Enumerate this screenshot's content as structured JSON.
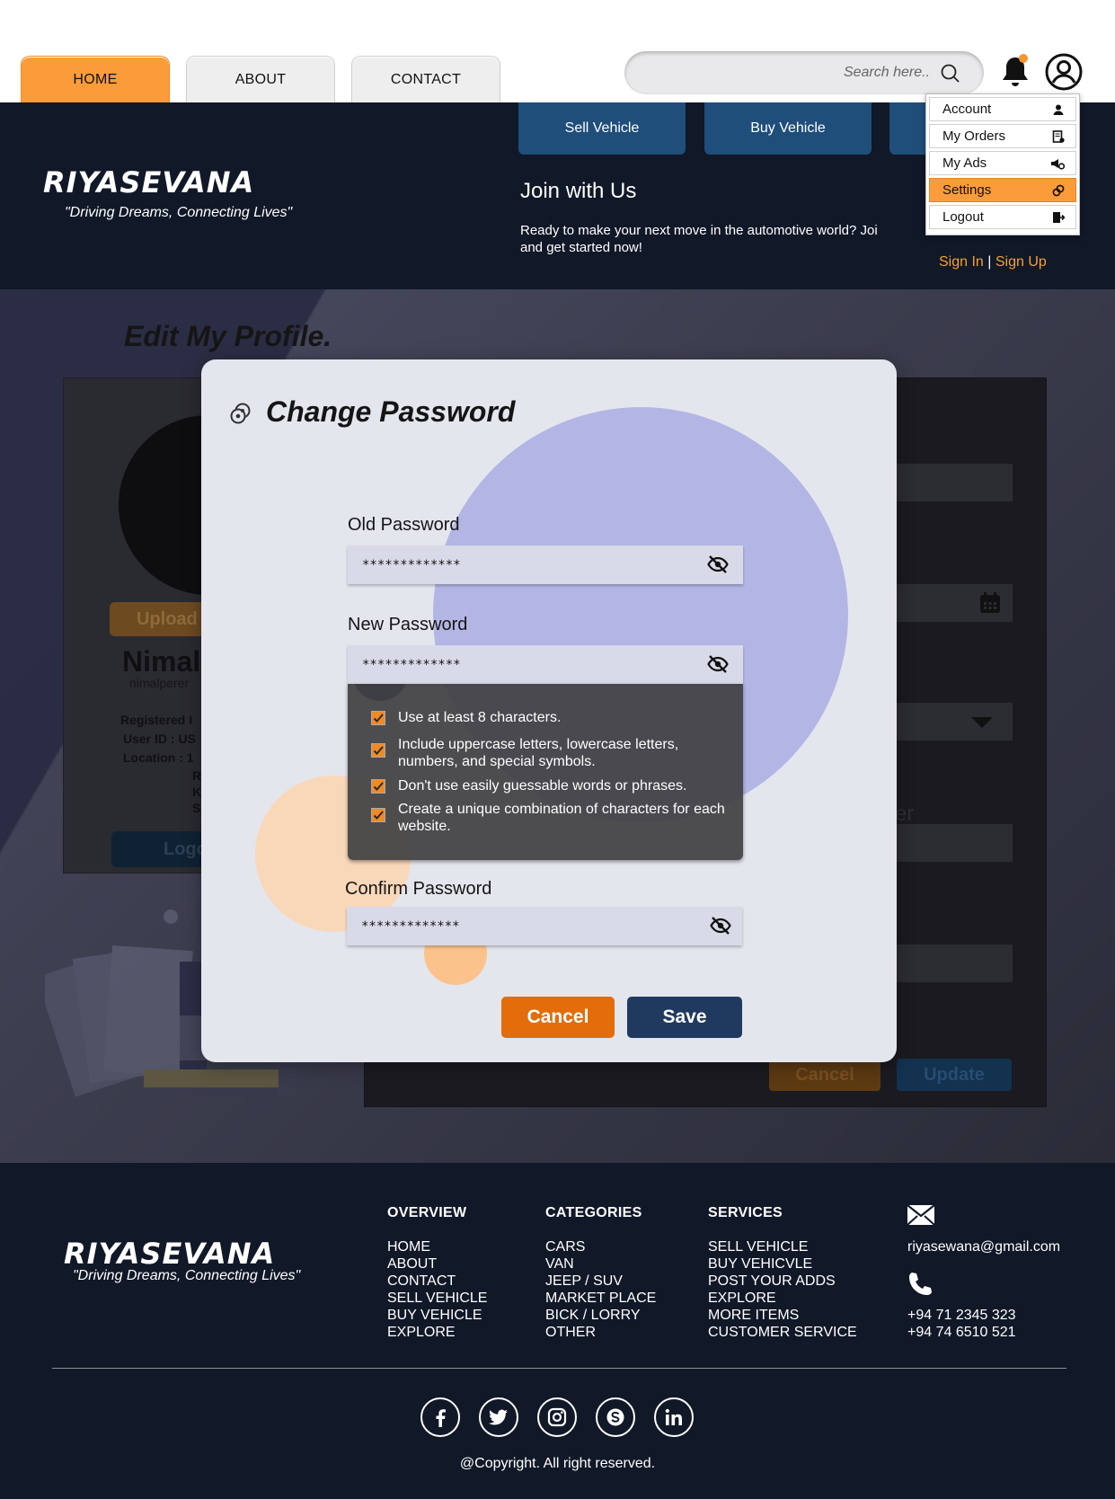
{
  "nav": {
    "tabs": [
      {
        "label": "HOME",
        "active": true
      },
      {
        "label": "ABOUT",
        "active": false
      },
      {
        "label": "CONTACT",
        "active": false
      }
    ],
    "search_placeholder": "Search here..",
    "accent_color": "#fb9b3a"
  },
  "header": {
    "brand": "RIYASEVANA",
    "tagline": "\"Driving Dreams, Connecting Lives\"",
    "actions": [
      "Sell Vehicle",
      "Buy Vehicle"
    ],
    "join_title": "Join with Us",
    "join_text": "Ready to make your next move in the automotive world? Joi",
    "join_text_2": "and get started now!",
    "sign_in": "Sign In",
    "separator": "|",
    "sign_up": "Sign Up"
  },
  "user_menu": {
    "items": [
      {
        "label": "Account",
        "icon": "user-icon",
        "active": false
      },
      {
        "label": "My Orders",
        "icon": "orders-icon",
        "active": false
      },
      {
        "label": "My Ads",
        "icon": "ads-icon",
        "active": false
      },
      {
        "label": "Settings",
        "icon": "settings-icon",
        "active": true
      },
      {
        "label": "Logout",
        "icon": "logout-icon",
        "active": false
      }
    ]
  },
  "profile_page": {
    "title": "Edit My Profile.",
    "upload_label": "Upload",
    "name": "Nimal",
    "email": "nimalperer",
    "registered_label": "Registered I",
    "user_id_label": "User ID : US",
    "location_label": "Location : 1",
    "loc_line_2": "R",
    "loc_line_3": "K",
    "loc_line_4": "S",
    "logout_label": "Logo",
    "field_fragment": "er",
    "cancel_label": "Cancel",
    "update_label": "Update"
  },
  "modal": {
    "title": "Change Password",
    "old_label": "Old Password",
    "old_value": "*************",
    "new_label": "New Password",
    "new_value": "*************",
    "confirm_label": "Confirm Password",
    "confirm_value": "*************",
    "rules": [
      "Use at least 8 characters.",
      " Include uppercase letters, lowercase letters, numbers, and special symbols.",
      "Don't use easily guessable words or phrases.",
      "Create a unique combination of characters for each website."
    ],
    "cancel_label": "Cancel",
    "save_label": "Save",
    "cancel_color": "#e46d0b",
    "save_color": "#203a5f"
  },
  "footer": {
    "brand": "RIYASEVANA",
    "tagline": "\"Driving Dreams, Connecting Lives\"",
    "overview": {
      "title": "OVERVIEW",
      "items": [
        "HOME",
        "ABOUT",
        "CONTACT",
        "SELL VEHICLE",
        "BUY VEHICLE",
        "EXPLORE"
      ]
    },
    "categories": {
      "title": "CATEGORIES",
      "items": [
        "CARS",
        "VAN",
        "JEEP / SUV",
        "MARKET PLACE",
        "BICK / LORRY",
        "OTHER"
      ]
    },
    "services": {
      "title": "SERVICES",
      "items": [
        "SELL VEHICLE",
        "BUY VEHICVLE",
        "POST YOUR ADDS",
        "EXPLORE",
        "MORE ITEMS",
        "CUSTOMER SERVICE"
      ]
    },
    "email": "riyasewana@gmail.com",
    "phone_1": "+94 71 2345 323",
    "phone_2": "+94 74 6510 521",
    "social": [
      "facebook-icon",
      "twitter-icon",
      "instagram-icon",
      "skype-icon",
      "linkedin-icon"
    ],
    "copyright": "@Copyright. All right reserved."
  }
}
